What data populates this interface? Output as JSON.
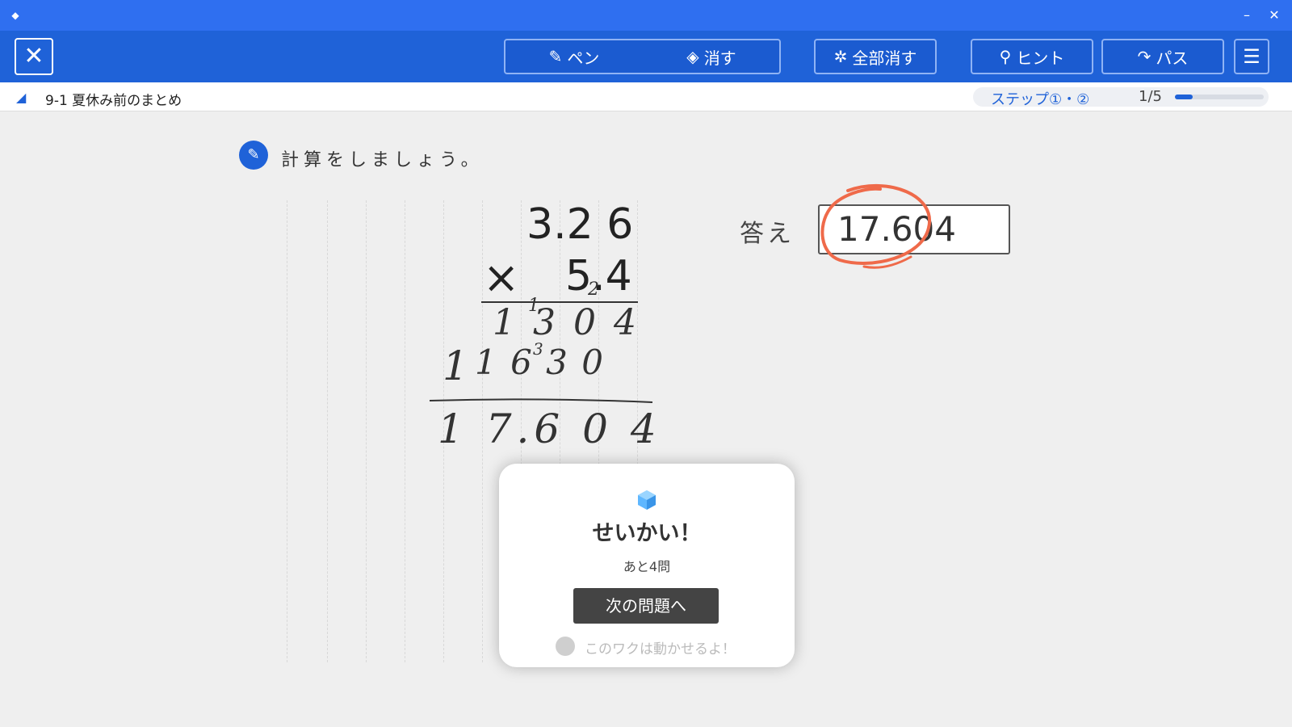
{
  "titlebar": {
    "app_icon": "diamond-icon",
    "minimize": "–",
    "close": "✕"
  },
  "toolbar": {
    "close_symbol": "✕",
    "pen_label": "ペン",
    "erase_label": "消す",
    "clear_all_label": "全部消す",
    "hint_label": "ヒント",
    "pass_label": "パス",
    "menu_symbol": "☰",
    "icons": {
      "pen": "✎",
      "erase": "◈",
      "clear_all": "✲",
      "hint": "⚲",
      "pass": "↷"
    }
  },
  "breadcrumb": {
    "text": "9-1  夏休み前のまとめ",
    "icon": "◢"
  },
  "progress": {
    "step_label": "ステップ①・②",
    "count": "1/5",
    "fraction": 0.2
  },
  "instruction": {
    "icon": "✎",
    "text": "計算をしましょう。"
  },
  "problem": {
    "multiplicand": "3.2 6",
    "operator": "×",
    "multiplier": "5.4"
  },
  "handwriting": {
    "carry_top": "2",
    "row1": "1 3 0 4",
    "row1_carry": "1",
    "row2": "1 6 3 0",
    "row2_carry": "3",
    "row2_extra": "1",
    "result": "1 7.6 0 4"
  },
  "answer": {
    "label": "答え",
    "value": "17.604"
  },
  "popup": {
    "title": "せいかい！",
    "remaining": "あと4問",
    "next_button": "次の問題へ",
    "hint": "このワクは動かせるよ！"
  },
  "colors": {
    "titlebar": "#2f6ff0",
    "toolbar": "#1f62d8",
    "correct_circle": "#ef6a4a"
  }
}
